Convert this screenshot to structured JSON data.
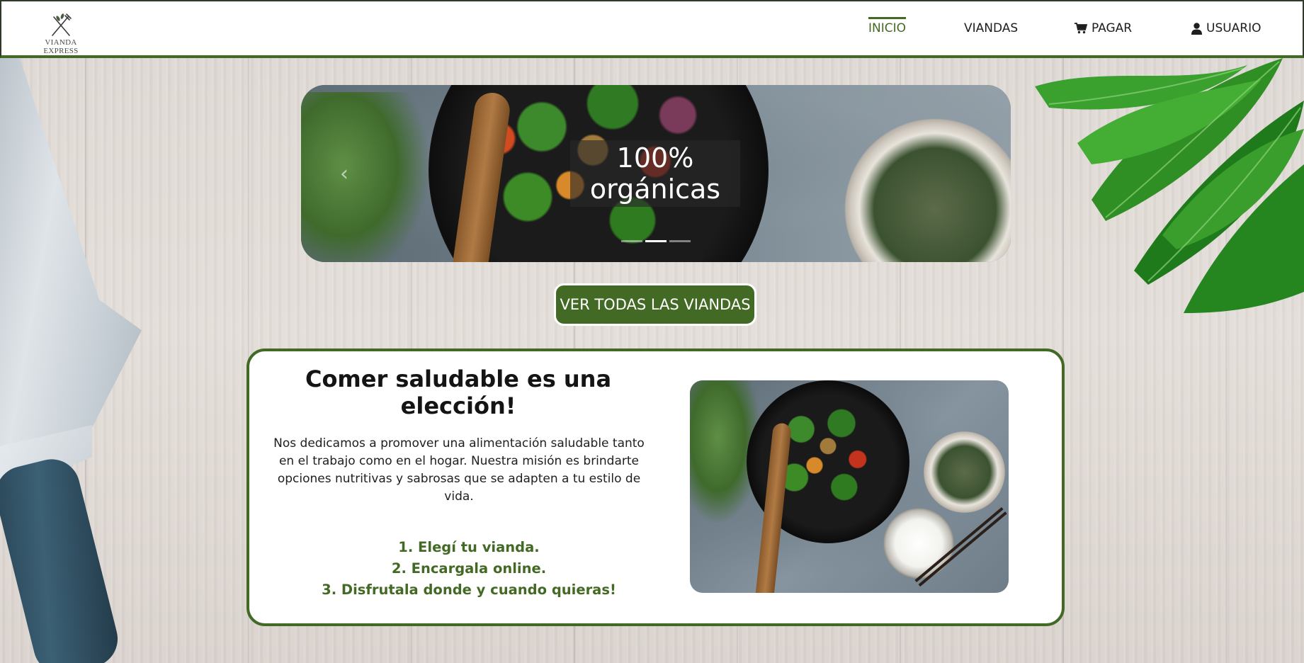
{
  "brand": {
    "name": "VIANDA EXPRESS",
    "logo_icon": "fork-knife-icon"
  },
  "nav": {
    "items": [
      {
        "label": "INICIO",
        "active": true,
        "icon": ""
      },
      {
        "label": "VIANDAS",
        "active": false,
        "icon": ""
      },
      {
        "label": "PAGAR",
        "active": false,
        "icon": "cart-icon"
      },
      {
        "label": "USUARIO",
        "active": false,
        "icon": "user-icon"
      }
    ]
  },
  "carousel": {
    "caption_line1": "100%",
    "caption_line2": "orgánicas",
    "prev_arrow": "‹",
    "indicator_count": 3,
    "active_indicator": 2
  },
  "cta": {
    "label": "VER TODAS LAS VIANDAS"
  },
  "info": {
    "title": "Comer saludable es una elección!",
    "text": "Nos dedicamos a promover una alimentación saludable tanto en el trabajo como en el hogar. Nuestra misión es brindarte opciones nutritivas y sabrosas que se adapten a tu estilo de vida.",
    "steps": [
      "1. Elegí tu vianda.",
      "2. Encargala online.",
      "3. Disfrutala donde y cuando quieras!"
    ]
  },
  "colors": {
    "accent": "#436a24",
    "header_bg": "#ffffff",
    "card_bg": "#ffffff",
    "text": "#1e1e1e"
  }
}
